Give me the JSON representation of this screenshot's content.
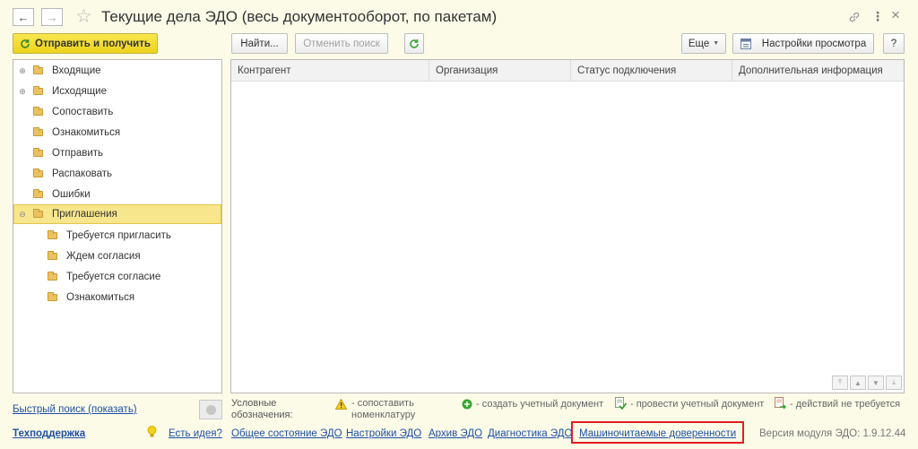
{
  "window": {
    "title": "Текущие дела ЭДО (весь документооборот, по пакетам)",
    "back_icon": "←",
    "forward_icon": "→",
    "star_icon": "☆",
    "link_icon": "🔗",
    "more_icon": "⋮",
    "close_icon": "×"
  },
  "toolbar": {
    "send_receive_label": "Отправить и получить",
    "find_label": "Найти...",
    "cancel_search_label": "Отменить поиск",
    "more_label": "Еще",
    "view_settings_label": "Настройки просмотра",
    "help_label": "?"
  },
  "tree": {
    "items": [
      {
        "label": "Входящие"
      },
      {
        "label": "Исходящие"
      },
      {
        "label": "Сопоставить"
      },
      {
        "label": "Ознакомиться"
      },
      {
        "label": "Отправить"
      },
      {
        "label": "Распаковать"
      },
      {
        "label": "Ошибки"
      },
      {
        "label": "Приглашения"
      },
      {
        "label": "Требуется пригласить"
      },
      {
        "label": "Ждем согласия"
      },
      {
        "label": "Требуется согласие"
      },
      {
        "label": "Ознакомиться"
      }
    ]
  },
  "table": {
    "columns": [
      {
        "label": "Контрагент"
      },
      {
        "label": "Организация"
      },
      {
        "label": "Статус подключения"
      },
      {
        "label": "Дополнительная информация"
      }
    ]
  },
  "footer": {
    "quick_search_link": "Быстрый поиск (показать)",
    "legend_title_1": "Условные",
    "legend_title_2": "обозначения:",
    "legend_match_1": "- сопоставить",
    "legend_match_2": "номенклатуру",
    "legend_create": "- создать учетный документ",
    "legend_post": "- провести учетный документ",
    "legend_none": "- действий не требуется",
    "support_link": "Техподдержка",
    "idea_link": "Есть идея?",
    "status_link": "Общее состояние ЭДО",
    "settings_link": "Настройки ЭДО",
    "archive_link": "Архив ЭДО",
    "diagnostics_link": "Диагностика ЭДО",
    "proxies_link": "Машиночитаемые доверенности",
    "version_text": "Версия модуля ЭДО: 1.9.12.44"
  },
  "colors": {
    "accent_yellow": "#f0d82c",
    "selected_row": "#f8e68c",
    "link_blue": "#1f4fa5",
    "highlight_red": "#e01f1f",
    "green_icon": "#3aa335"
  }
}
